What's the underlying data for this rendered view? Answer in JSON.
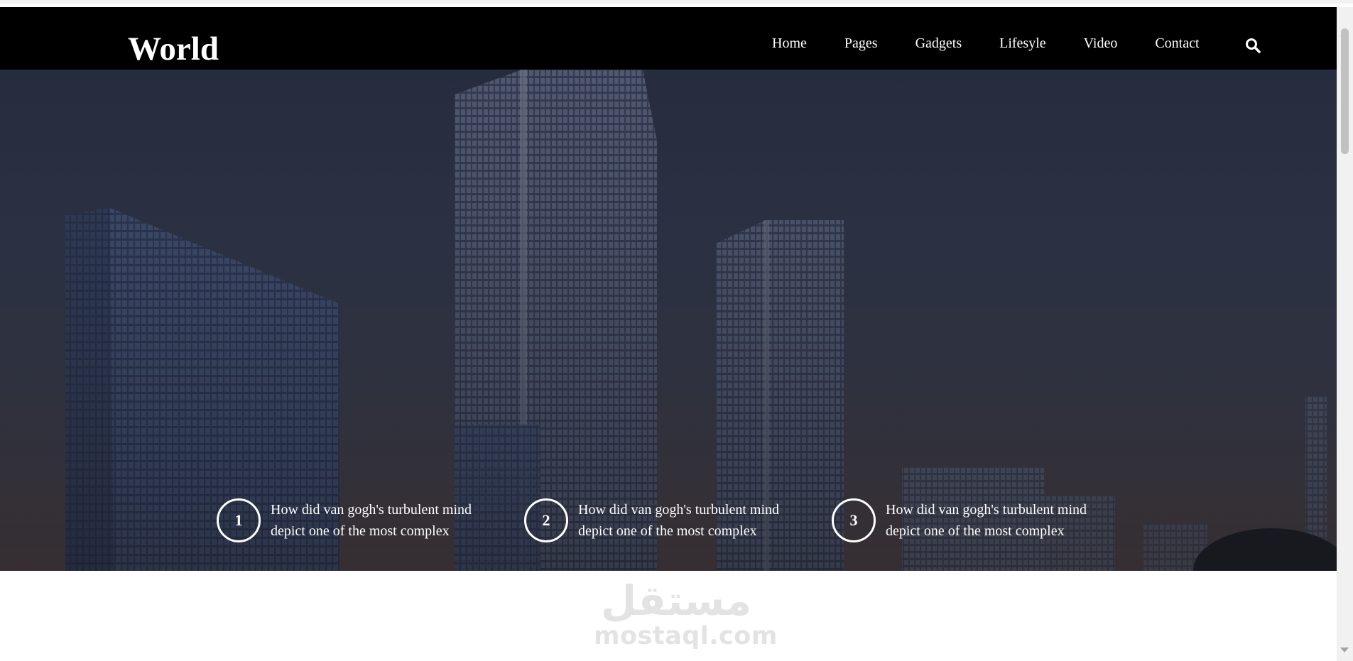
{
  "header": {
    "logo": "World",
    "nav": [
      "Home",
      "Pages",
      "Gadgets",
      "Lifesyle",
      "Video",
      "Contact"
    ],
    "search_icon": "search-icon"
  },
  "hero": {
    "features": [
      {
        "number": "1",
        "line1": "How did van gogh's turbulent mind",
        "line2": "depict one of the most complex"
      },
      {
        "number": "2",
        "line1": "How did van gogh's turbulent mind",
        "line2": "depict one of the most complex"
      },
      {
        "number": "3",
        "line1": "How did van gogh's turbulent mind",
        "line2": "depict one of the most complex"
      }
    ]
  },
  "watermark": {
    "arabic": "مستقل",
    "text": "mostaql.com"
  },
  "colors": {
    "header_bg": "#000000",
    "text_light": "#ffffff",
    "watermark": "#e3e3e3"
  }
}
